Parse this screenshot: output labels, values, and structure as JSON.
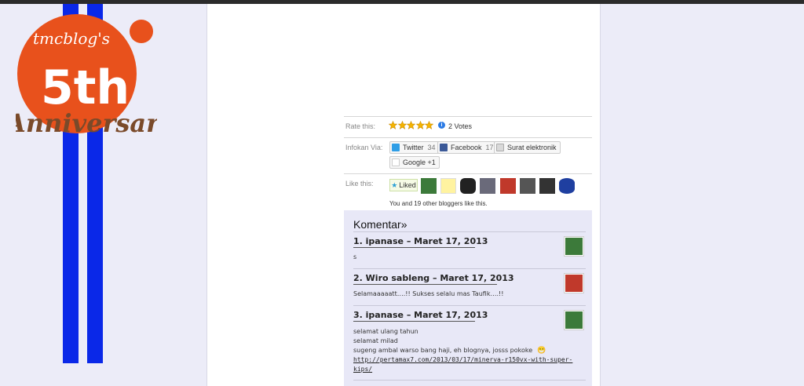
{
  "badge": {
    "blog_name": "tmcblog's",
    "number": "5th",
    "subtitle": "Anniversary",
    "colors": {
      "circle": "#e8511c",
      "stripe": "#0a28e8",
      "script": "#7a4a2a"
    }
  },
  "rate": {
    "label": "Rate this:",
    "stars": 5,
    "votes": "2 Votes"
  },
  "share": {
    "label": "Infokan Via:",
    "buttons": [
      {
        "label": "Twitter",
        "count": "34",
        "icon": "twitter-icon"
      },
      {
        "label": "Facebook",
        "count": "17",
        "icon": "facebook-icon"
      },
      {
        "label": "Surat elektronik",
        "count": "",
        "icon": "email-icon"
      },
      {
        "label": "Google +1",
        "count": "",
        "icon": "google-plus-icon"
      }
    ]
  },
  "like": {
    "label": "Like this:",
    "button": "Liked",
    "button_icon": "star-icon",
    "summary": "You and 19 other bloggers like this."
  },
  "comments": {
    "title": "Komentar»",
    "items": [
      {
        "heading": "1. ipanase – Maret 17, 2013",
        "lines": [
          "s"
        ],
        "link": ""
      },
      {
        "heading": "2. Wiro sableng – Maret 17, 2013",
        "lines": [
          "Selamaaaaatt….!! Sukses selalu mas Taufik….!!"
        ],
        "link": ""
      },
      {
        "heading": "3. ipanase – Maret 17, 2013",
        "lines": [
          "selamat ulang tahun",
          "selamat milad",
          "sugeng ambal warso bang haji, eh blognya, josss pokoke"
        ],
        "link_1": "http://pertamax7.com/2013/03/17/minerva-r150vx-with-super-",
        "link_2": "kips/"
      }
    ]
  }
}
